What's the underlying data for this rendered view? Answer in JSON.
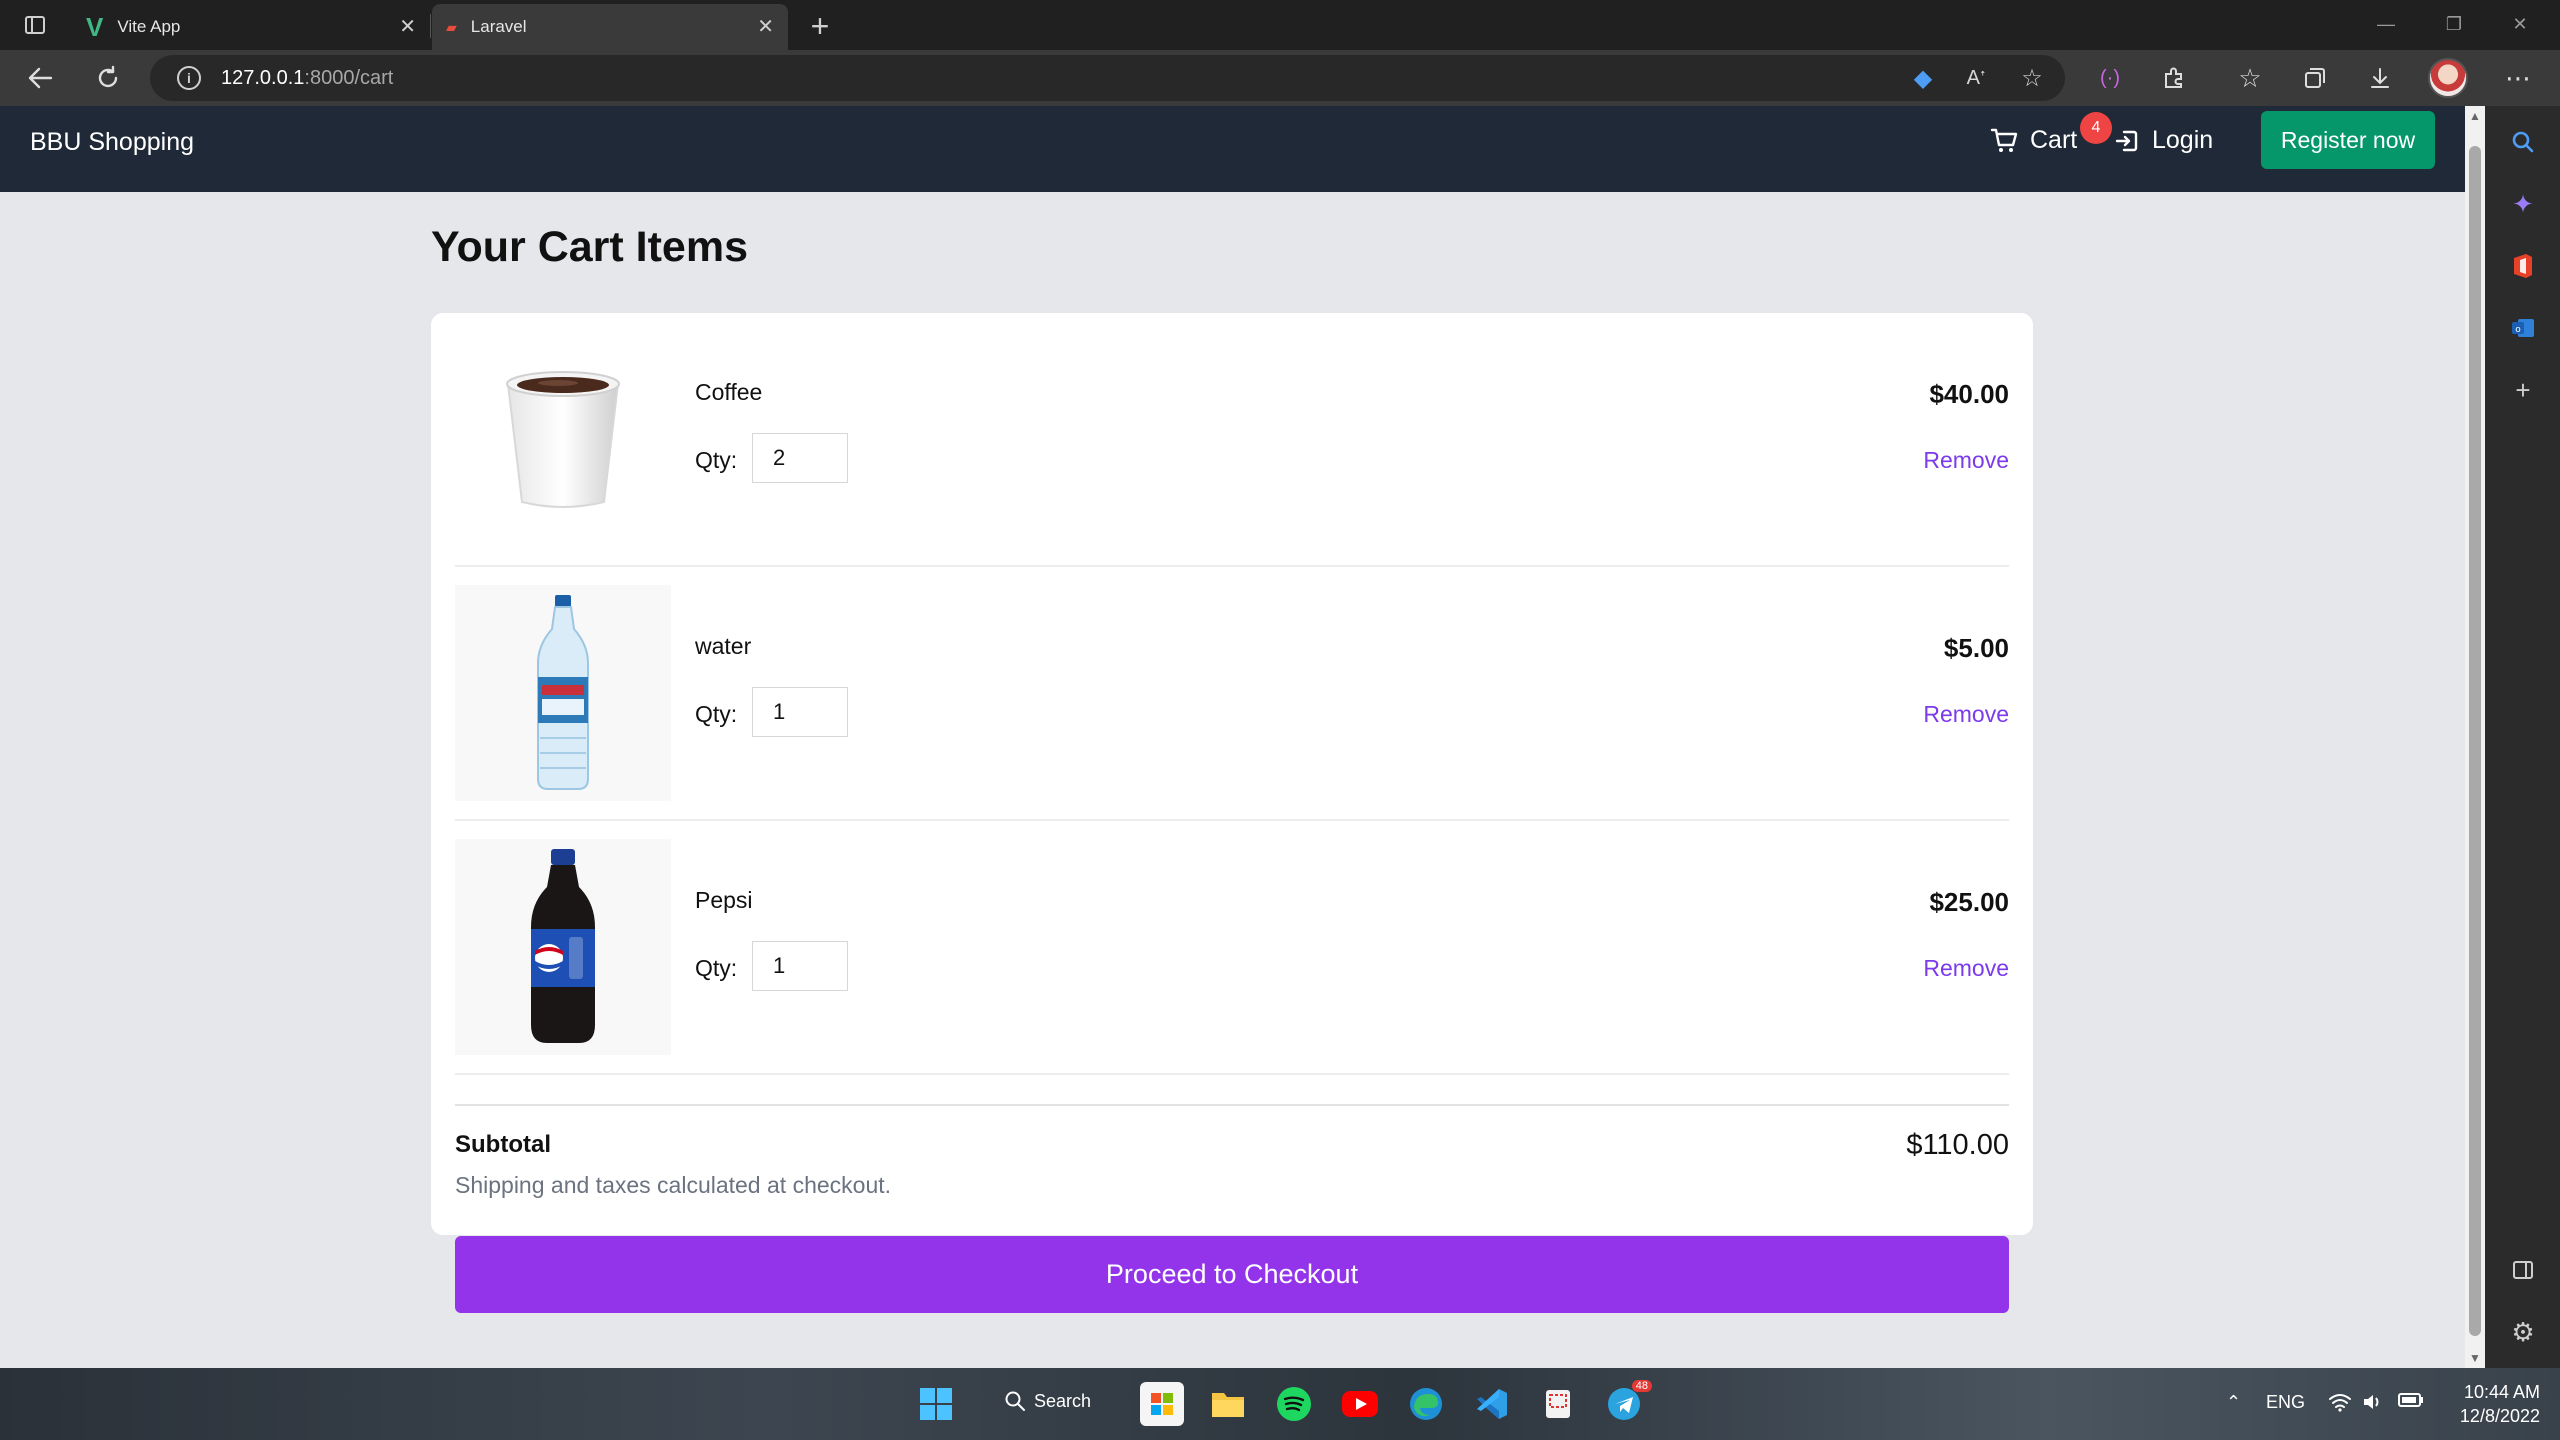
{
  "browser": {
    "tabs": [
      {
        "title": "Vite App"
      },
      {
        "title": "Laravel"
      }
    ],
    "address": {
      "host": "127.0.0.1",
      "rest": ":8000/cart"
    }
  },
  "navbar": {
    "brand": "BBU Shopping",
    "cart_label": "Cart",
    "cart_count": "4",
    "login_label": "Login",
    "register_label": "Register now"
  },
  "cart": {
    "heading": "Your Cart Items",
    "items": [
      {
        "name": "Coffee",
        "qty_label": "Qty:",
        "qty": "2",
        "price": "$40.00",
        "remove_label": "Remove"
      },
      {
        "name": "water",
        "qty_label": "Qty:",
        "qty": "1",
        "price": "$5.00",
        "remove_label": "Remove"
      },
      {
        "name": "Pepsi",
        "qty_label": "Qty:",
        "qty": "1",
        "price": "$25.00",
        "remove_label": "Remove"
      }
    ],
    "subtotal_label": "Subtotal",
    "subtotal_value": "$110.00",
    "shipping_note": "Shipping and taxes calculated at checkout.",
    "checkout_label": "Proceed to Checkout"
  },
  "taskbar": {
    "search_label": "Search",
    "telegram_badge": "48",
    "language": "ENG",
    "time": "10:44 AM",
    "date": "12/8/2022"
  },
  "colors": {
    "navbar_bg": "#1f2937",
    "register_button": "#059669",
    "checkout_button": "#9333ea",
    "remove_link": "#7c3aed",
    "cart_badge": "#ef4444"
  }
}
